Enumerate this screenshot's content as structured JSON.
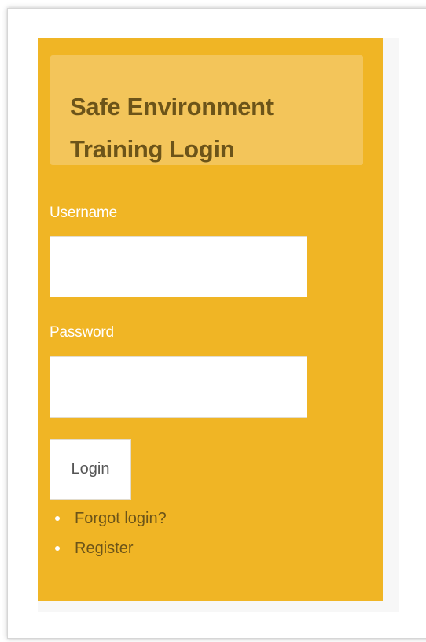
{
  "login": {
    "title": "Safe Environment Training Login",
    "username_label": "Username",
    "username_value": "",
    "password_label": "Password",
    "password_value": "",
    "login_button": "Login",
    "links": [
      {
        "label": "Forgot login?"
      },
      {
        "label": "Register"
      }
    ]
  },
  "colors": {
    "panel": "#f0b525",
    "title_box": "#f3c55a",
    "title_text": "#6c5419",
    "label_text": "#ffffff"
  }
}
